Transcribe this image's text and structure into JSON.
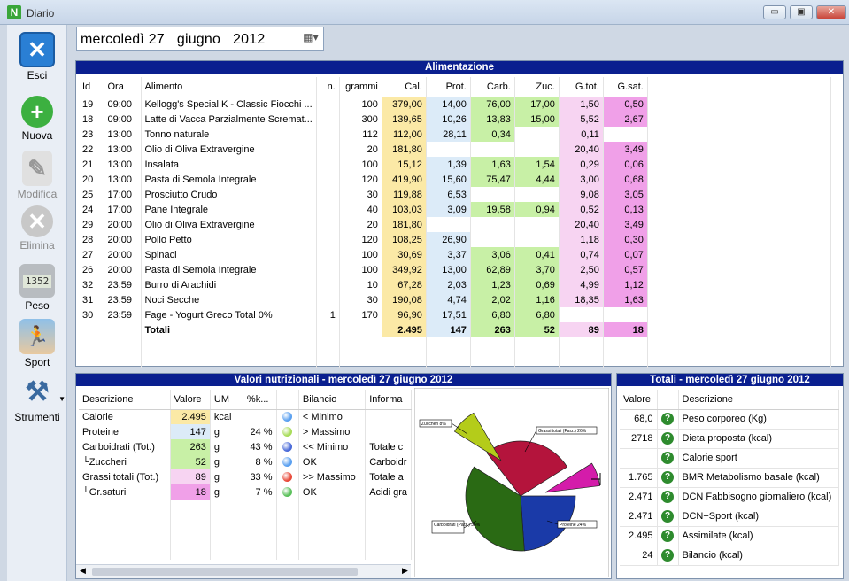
{
  "window": {
    "title": "Diario",
    "min": "▭",
    "max": "▣",
    "close": "✕"
  },
  "date": {
    "weekday": "mercoledì",
    "day": "27",
    "month": "giugno",
    "year": "2012"
  },
  "sidebar": [
    {
      "label": "Esci"
    },
    {
      "label": "Nuova"
    },
    {
      "label": "Modifica"
    },
    {
      "label": "Elimina"
    },
    {
      "label": "Peso",
      "screen": "1352"
    },
    {
      "label": "Sport"
    },
    {
      "label": "Strumenti"
    }
  ],
  "alimentazione": {
    "title": "Alimentazione",
    "headers": [
      "Id",
      "Ora",
      "Alimento",
      "n.",
      "grammi",
      "Cal.",
      "Prot.",
      "Carb.",
      "Zuc.",
      "G.tot.",
      "G.sat."
    ],
    "rows": [
      [
        "19",
        "09:00",
        "Kellogg's Special K - Classic Fiocchi ...",
        "",
        "100",
        "379,00",
        "14,00",
        "76,00",
        "17,00",
        "1,50",
        "0,50"
      ],
      [
        "18",
        "09:00",
        "Latte di Vacca Parzialmente Scremat...",
        "",
        "300",
        "139,65",
        "10,26",
        "13,83",
        "15,00",
        "5,52",
        "2,67"
      ],
      [
        "23",
        "13:00",
        "Tonno naturale",
        "",
        "112",
        "112,00",
        "28,11",
        "0,34",
        "",
        "0,11",
        ""
      ],
      [
        "22",
        "13:00",
        "Olio di Oliva Extravergine",
        "",
        "20",
        "181,80",
        "",
        "",
        "",
        "20,40",
        "3,49"
      ],
      [
        "21",
        "13:00",
        "Insalata",
        "",
        "100",
        "15,12",
        "1,39",
        "1,63",
        "1,54",
        "0,29",
        "0,06"
      ],
      [
        "20",
        "13:00",
        "Pasta di Semola Integrale",
        "",
        "120",
        "419,90",
        "15,60",
        "75,47",
        "4,44",
        "3,00",
        "0,68"
      ],
      [
        "25",
        "17:00",
        "Prosciutto Crudo",
        "",
        "30",
        "119,88",
        "6,53",
        "",
        "",
        "9,08",
        "3,05"
      ],
      [
        "24",
        "17:00",
        "Pane Integrale",
        "",
        "40",
        "103,03",
        "3,09",
        "19,58",
        "0,94",
        "0,52",
        "0,13"
      ],
      [
        "29",
        "20:00",
        "Olio di Oliva Extravergine",
        "",
        "20",
        "181,80",
        "",
        "",
        "",
        "20,40",
        "3,49"
      ],
      [
        "28",
        "20:00",
        "Pollo Petto",
        "",
        "120",
        "108,25",
        "26,90",
        "",
        "",
        "1,18",
        "0,30"
      ],
      [
        "27",
        "20:00",
        "Spinaci",
        "",
        "100",
        "30,69",
        "3,37",
        "3,06",
        "0,41",
        "0,74",
        "0,07"
      ],
      [
        "26",
        "20:00",
        "Pasta di Semola Integrale",
        "",
        "100",
        "349,92",
        "13,00",
        "62,89",
        "3,70",
        "2,50",
        "0,57"
      ],
      [
        "32",
        "23:59",
        "Burro di Arachidi",
        "",
        "10",
        "67,28",
        "2,03",
        "1,23",
        "0,69",
        "4,99",
        "1,12"
      ],
      [
        "31",
        "23:59",
        "Noci Secche",
        "",
        "30",
        "190,08",
        "4,74",
        "2,02",
        "1,16",
        "18,35",
        "1,63"
      ],
      [
        "30",
        "23:59",
        "Fage - Yogurt Greco Total 0%",
        "1",
        "170",
        "96,90",
        "17,51",
        "6,80",
        "6,80",
        "",
        ""
      ]
    ],
    "totals": {
      "label": "Totali",
      "cal": "2.495",
      "prot": "147",
      "carb": "263",
      "zuc": "52",
      "gtot": "89",
      "gsat": "18"
    }
  },
  "valori": {
    "title": "Valori nutrizionali - mercoledì 27 giugno 2012",
    "headers": [
      "Descrizione",
      "Valore",
      "UM",
      "%k...",
      "",
      "Bilancio",
      "Informa"
    ],
    "rows": [
      {
        "desc": "Calorie",
        "val": "2.495",
        "um": "kcal",
        "pct": "",
        "dot": "#5aa0f0",
        "bil": "< Minimo",
        "info": ""
      },
      {
        "desc": "Proteine",
        "val": "147",
        "um": "g",
        "pct": "24 %",
        "dot": "#a8dc5a",
        "bil": "> Massimo",
        "info": ""
      },
      {
        "desc": "Carboidrati (Tot.)",
        "val": "263",
        "um": "g",
        "pct": "43 %",
        "dot": "#4a6ad8",
        "bil": "<< Minimo",
        "info": "Totale c"
      },
      {
        "desc": "└Zuccheri",
        "val": "52",
        "um": "g",
        "pct": "8 %",
        "dot": "#5aa0f0",
        "bil": "OK",
        "info": "Carboidr"
      },
      {
        "desc": "Grassi totali (Tot.)",
        "val": "89",
        "um": "g",
        "pct": "33 %",
        "dot": "#e84a3a",
        "bil": ">> Massimo",
        "info": "Totale a"
      },
      {
        "desc": "└Gr.saturi",
        "val": "18",
        "um": "g",
        "pct": "7 %",
        "dot": "#5ac05a",
        "bil": "OK",
        "info": "Acidi gra"
      }
    ]
  },
  "pie": {
    "labels": {
      "zuc": "Zuccheri 8%",
      "grassi": "Grassi totali (Parz.) 26%",
      "carb": "Carboidrati (Parz.) 35%",
      "prot": "Proteine 24%"
    }
  },
  "chart_data": {
    "type": "pie",
    "categories": [
      "Proteine",
      "Carboidrati (Parz.)",
      "Zuccheri",
      "Grassi totali (Parz.)",
      "Gr.saturi"
    ],
    "values": [
      24,
      35,
      8,
      26,
      7
    ]
  },
  "totali": {
    "title": "Totali - mercoledì 27 giugno 2012",
    "headers": [
      "Valore",
      "",
      "Descrizione"
    ],
    "rows": [
      {
        "val": "68,0",
        "desc": "Peso corporeo (Kg)"
      },
      {
        "val": "2718",
        "desc": "Dieta proposta (kcal)"
      },
      {
        "val": "",
        "desc": "Calorie sport"
      },
      {
        "val": "1.765",
        "desc": "BMR Metabolismo basale (kcal)"
      },
      {
        "val": "2.471",
        "desc": "DCN Fabbisogno giornaliero (kcal)"
      },
      {
        "val": "2.471",
        "desc": "DCN+Sport (kcal)"
      },
      {
        "val": "2.495",
        "desc": "Assimilate (kcal)"
      },
      {
        "val": "24",
        "desc": "Bilancio (kcal)"
      }
    ]
  }
}
